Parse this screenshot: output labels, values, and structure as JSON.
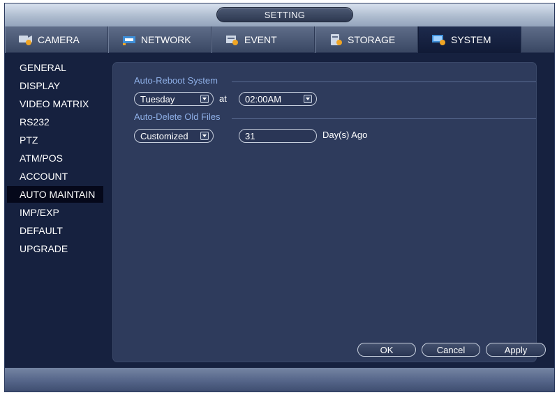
{
  "window": {
    "title": "SETTING"
  },
  "tabs": [
    {
      "label": "CAMERA",
      "icon": "camera-icon"
    },
    {
      "label": "NETWORK",
      "icon": "network-icon"
    },
    {
      "label": "EVENT",
      "icon": "event-icon"
    },
    {
      "label": "STORAGE",
      "icon": "storage-icon"
    },
    {
      "label": "SYSTEM",
      "icon": "system-icon",
      "active": true
    }
  ],
  "sidebar": {
    "items": [
      {
        "label": "GENERAL"
      },
      {
        "label": "DISPLAY"
      },
      {
        "label": "VIDEO MATRIX"
      },
      {
        "label": "RS232"
      },
      {
        "label": "PTZ"
      },
      {
        "label": "ATM/POS"
      },
      {
        "label": "ACCOUNT"
      },
      {
        "label": "AUTO MAINTAIN",
        "active": true
      },
      {
        "label": "IMP/EXP"
      },
      {
        "label": "DEFAULT"
      },
      {
        "label": "UPGRADE"
      }
    ]
  },
  "auto_reboot": {
    "section_label": "Auto-Reboot System",
    "day_value": "Tuesday",
    "at_label": "at",
    "time_value": "02:00AM"
  },
  "auto_delete": {
    "section_label": "Auto-Delete Old Files",
    "mode_value": "Customized",
    "days_value": "31",
    "days_suffix": "Day(s) Ago"
  },
  "buttons": {
    "ok": "OK",
    "cancel": "Cancel",
    "apply": "Apply"
  },
  "colors": {
    "background": "#16213f",
    "panel": "#2e3b5c",
    "section_label": "#8fb0e8",
    "active_nav": "#05081a"
  }
}
